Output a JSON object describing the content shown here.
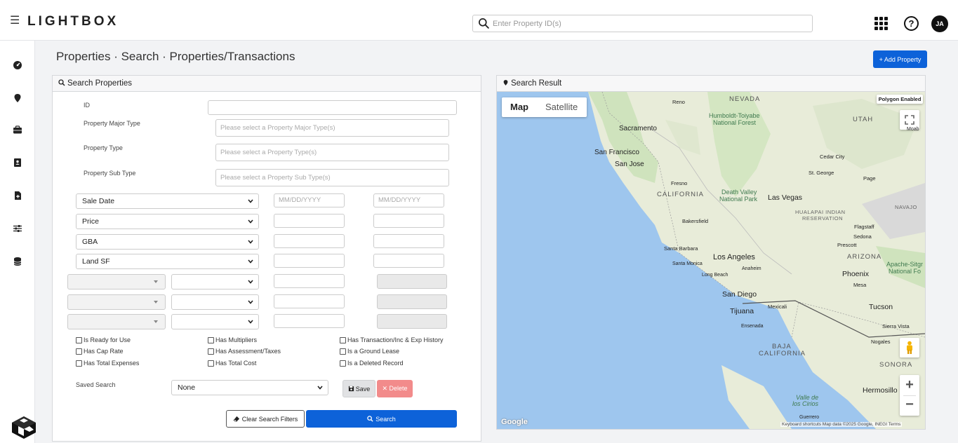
{
  "header": {
    "logo": "LIGHTBOX",
    "search_placeholder": "Enter Property ID(s)",
    "avatar_initials": "JA"
  },
  "page": {
    "title": "Properties · Search · Properties/Transactions",
    "add_button": "+ Add Property"
  },
  "search_panel": {
    "title": "Search Properties",
    "fields": {
      "id_label": "ID",
      "major_type_label": "Property Major Type",
      "major_type_placeholder": "Please select a Property Major Type(s)",
      "type_label": "Property Type",
      "type_placeholder": "Please select a Property Type(s)",
      "sub_type_label": "Property Sub Type",
      "sub_type_placeholder": "Please select a Property Sub Type(s)"
    },
    "range_rows": [
      {
        "select": "Sale Date",
        "from_placeholder": "MM/DD/YYYY",
        "to_placeholder": "MM/DD/YYYY"
      },
      {
        "select": "Price",
        "from_placeholder": "",
        "to_placeholder": ""
      },
      {
        "select": "GBA",
        "from_placeholder": "",
        "to_placeholder": ""
      },
      {
        "select": "Land SF",
        "from_placeholder": "",
        "to_placeholder": ""
      }
    ],
    "checkboxes": {
      "ready": "Is Ready for Use",
      "multipliers": "Has Multipliers",
      "transaction": "Has Transaction/Inc & Exp History",
      "cap_rate": "Has Cap Rate",
      "assessment": "Has Assessment/Taxes",
      "ground_lease": "Is a Ground Lease",
      "total_expenses": "Has Total Expenses",
      "total_cost": "Has Total Cost",
      "deleted": "Is a Deleted Record"
    },
    "saved_search_label": "Saved Search",
    "saved_search_value": "None",
    "save_button": "Save",
    "delete_button": "✕ Delete",
    "clear_button": "Clear Search Filters",
    "search_button": "Search"
  },
  "result_panel": {
    "title": "Search Result",
    "map_tab": "Map",
    "satellite_tab": "Satellite",
    "polygon_badge": "Polygon Enabled",
    "google": "Google",
    "attribution": "Keyboard shortcuts   Map data ©2025 Google, INEGI   Terms",
    "labels": {
      "nevada": "NEVADA",
      "reno": "Reno",
      "humboldt": "Humboldt-Toiyabe",
      "national_forest": "National Forest",
      "utah": "UTAH",
      "moab": "Moab",
      "sacramento": "Sacramento",
      "san_francisco": "San Francisco",
      "san_jose": "San Jose",
      "cedar_city": "Cedar City",
      "st_george": "St. George",
      "page": "Page",
      "fresno": "Fresno",
      "california": "CALIFORNIA",
      "death_valley": "Death Valley",
      "national_park": "National Park",
      "las_vegas": "Las Vegas",
      "hualapai": "HUALAPAI INDIAN",
      "reservation": "RESERVATION",
      "navajo": "NAVAJO",
      "bakersfield": "Bakersfield",
      "flagstaff": "Flagstaff",
      "sedona": "Sedona",
      "prescott": "Prescott",
      "santa_barbara": "Santa Barbara",
      "los_angeles": "Los Angeles",
      "santa_monica": "Santa Monica",
      "anaheim": "Anaheim",
      "long_beach": "Long Beach",
      "arizona": "ARIZONA",
      "apache": "Apache-Sitgr",
      "national_fo": "National Fo",
      "phoenix": "Phoenix",
      "mesa": "Mesa",
      "san_diego": "San Diego",
      "tijuana": "Tijuana",
      "mexicali": "Mexicali",
      "tucson": "Tucson",
      "ensenada": "Ensenada",
      "sierra_vista": "Sierra Vista",
      "nogales": "Nogales",
      "baja": "BAJA",
      "baja_california": "CALIFORNIA",
      "sonora": "SONORA",
      "hermosillo": "Hermosillo",
      "valle": "Valle de",
      "cirios": "los Cirios",
      "guerrero": "Guerrero"
    }
  }
}
